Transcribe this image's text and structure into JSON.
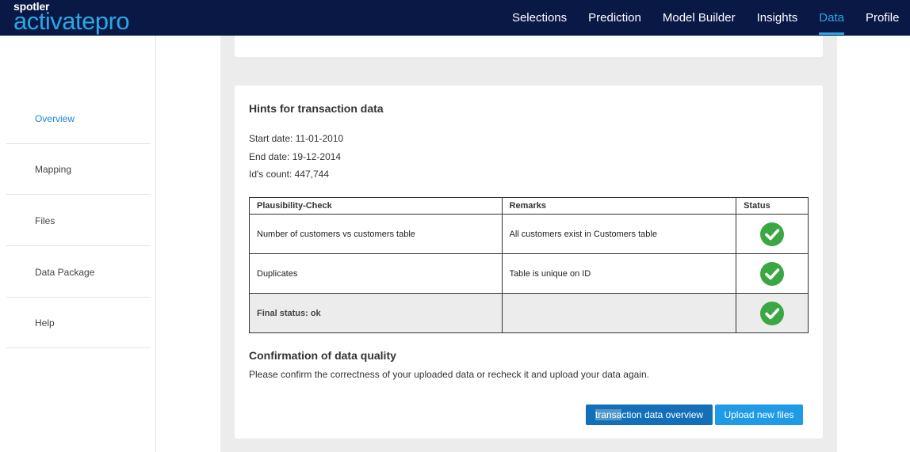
{
  "brand": {
    "top": "spotler",
    "bottom": "activatepro"
  },
  "nav": [
    {
      "label": "Selections",
      "active": false
    },
    {
      "label": "Prediction",
      "active": false
    },
    {
      "label": "Model Builder",
      "active": false
    },
    {
      "label": "Insights",
      "active": false
    },
    {
      "label": "Data",
      "active": true
    },
    {
      "label": "Profile",
      "active": false
    }
  ],
  "sidebar": {
    "items": [
      {
        "label": "Overview",
        "active": true
      },
      {
        "label": "Mapping",
        "active": false
      },
      {
        "label": "Files",
        "active": false
      },
      {
        "label": "Data Package",
        "active": false
      },
      {
        "label": "Help",
        "active": false
      }
    ]
  },
  "hints": {
    "title": "Hints for transaction data",
    "start_date": "Start date: 11-01-2010",
    "end_date": "End date: 19-12-2014",
    "ids_count": "Id's count: 447,744"
  },
  "table": {
    "headers": [
      "Plausibility-Check",
      "Remarks",
      "Status"
    ],
    "rows": [
      {
        "check": "Number of customers vs customers table",
        "remarks": "All customers exist in Customers table",
        "status": "ok"
      },
      {
        "check": "Duplicates",
        "remarks": "Table is unique on ID",
        "status": "ok"
      },
      {
        "check": "Final status: ok",
        "remarks": "",
        "status": "ok"
      }
    ]
  },
  "confirmation": {
    "title": "Confirmation of data quality",
    "text": "Please confirm the correctness of your uploaded data or recheck it and upload your data again."
  },
  "buttons": {
    "overview_selected": "transa",
    "overview_rest": "ction data overview",
    "upload": "Upload new files"
  },
  "colors": {
    "topbar": "#0a1845",
    "accent": "#2aa7e6",
    "button_dark": "#136fb8",
    "button_light": "#1f9ae6",
    "check_green": "#3aa743"
  },
  "icons": {
    "status_ok": "check-circle-icon"
  }
}
